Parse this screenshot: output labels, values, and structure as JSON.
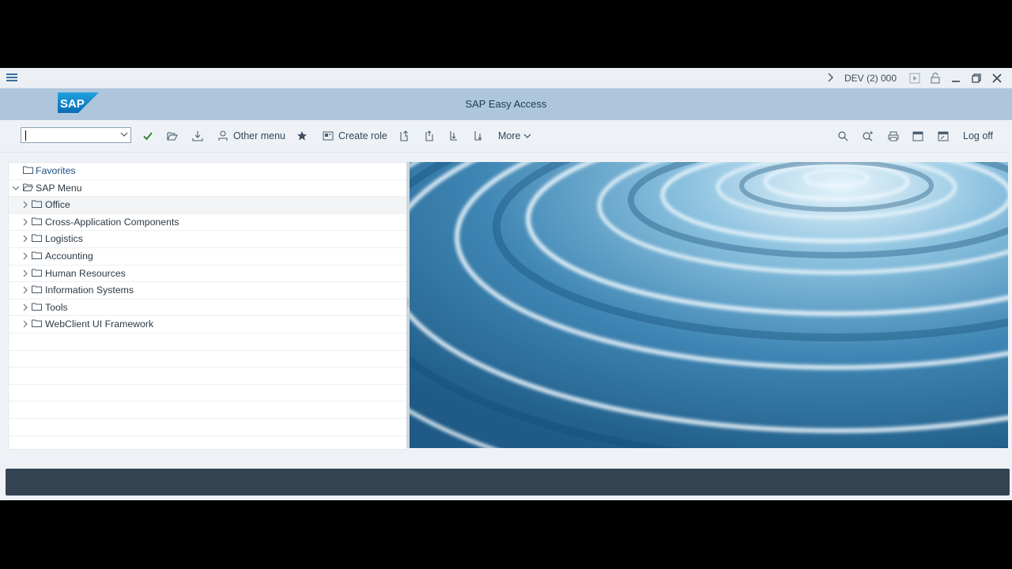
{
  "system": {
    "info": "DEV (2) 000",
    "icons": [
      "chevron-right-icon",
      "play-icon",
      "lock-icon",
      "minimize-icon",
      "restore-icon",
      "close-icon"
    ]
  },
  "titlebar": {
    "title": "SAP Easy Access",
    "logo_text": "SAP"
  },
  "toolbar": {
    "other_menu": "Other menu",
    "create_role": "Create role",
    "more": "More",
    "log_off": "Log off"
  },
  "tree": {
    "favorites": "Favorites",
    "sap_menu": "SAP Menu",
    "items": [
      "Office",
      "Cross-Application Components",
      "Logistics",
      "Accounting",
      "Human Resources",
      "Information Systems",
      "Tools",
      "WebClient UI Framework"
    ]
  },
  "colors": {
    "titlebar": "#aec6dc",
    "statusbar": "#354452",
    "link": "#1b4f84",
    "brand": "#1a8ad3"
  }
}
